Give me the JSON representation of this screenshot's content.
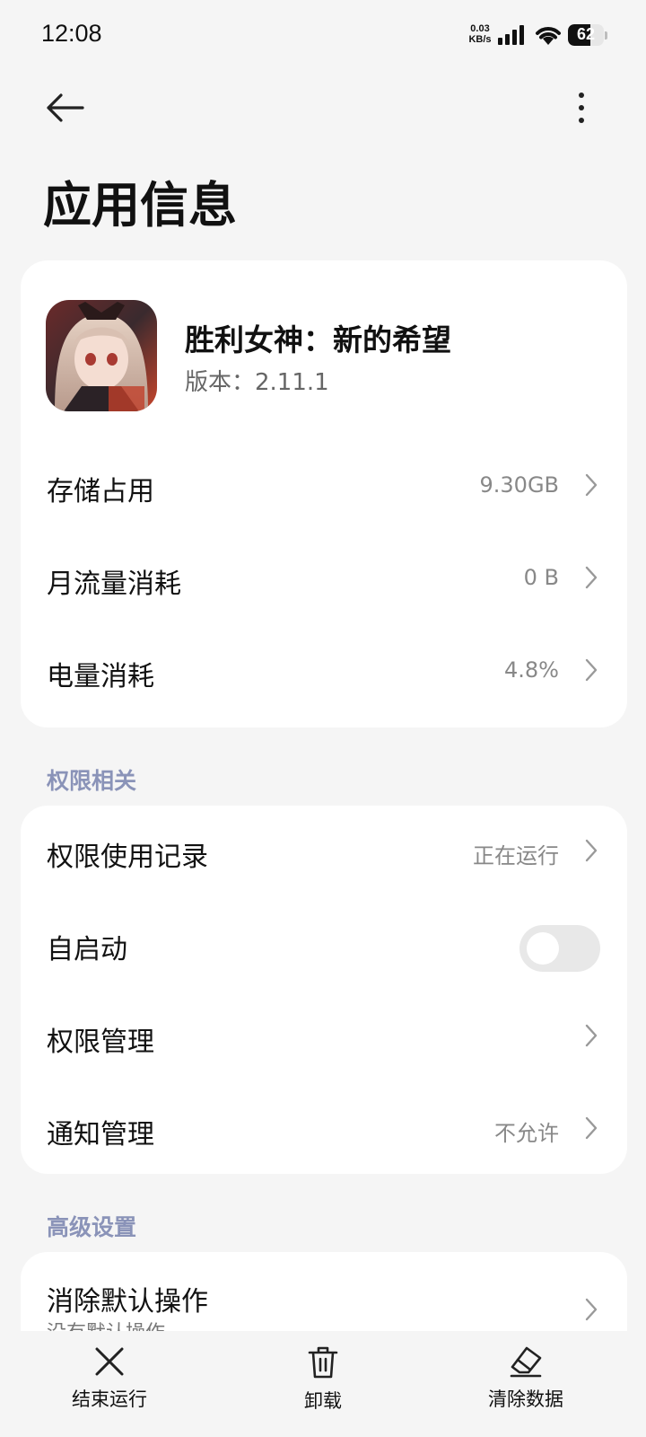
{
  "status_bar": {
    "time": "12:08",
    "net_speed_value": "0.03",
    "net_speed_unit": "KB/s",
    "battery": "62",
    "battery_level": 0.62
  },
  "header": {
    "title": "应用信息",
    "back_icon": "arrow-left-icon",
    "more_icon": "more-vertical-icon"
  },
  "app": {
    "name": "胜利女神：新的希望",
    "version": "版本：2.11.1",
    "icon": "app-icon"
  },
  "usage_rows": [
    {
      "label": "存储占用",
      "value": "9.30GB"
    },
    {
      "label": "月流量消耗",
      "value": "0 B"
    },
    {
      "label": "电量消耗",
      "value": "4.8%"
    }
  ],
  "permissions": {
    "section_title": "权限相关",
    "rows": [
      {
        "label": "权限使用记录",
        "value": "正在运行"
      },
      {
        "label": "自启动",
        "toggle_on": false
      },
      {
        "label": "权限管理",
        "value": ""
      },
      {
        "label": "通知管理",
        "value": "不允许"
      }
    ]
  },
  "advanced": {
    "section_title": "高级设置",
    "rows": [
      {
        "label": "消除默认操作",
        "sub": "没有默认操作"
      }
    ]
  },
  "bottom_actions": [
    {
      "label": "结束运行",
      "icon": "close-icon"
    },
    {
      "label": "卸载",
      "icon": "trash-icon"
    },
    {
      "label": "清除数据",
      "icon": "eraser-icon"
    }
  ],
  "colors": {
    "background": "#f5f5f5",
    "card": "#ffffff",
    "section_header": "#8a93b8",
    "secondary_text": "#888888"
  }
}
